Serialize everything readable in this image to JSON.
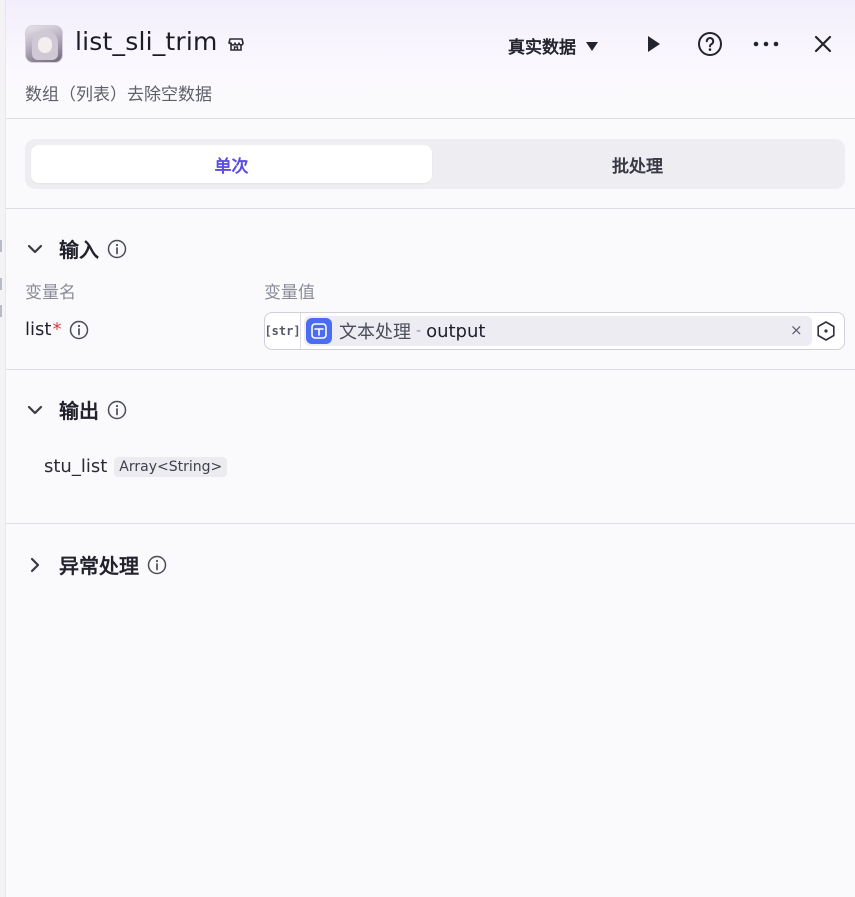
{
  "header": {
    "title": "list_sli_trim",
    "description": "数组（列表）去除空数据",
    "mode_select": "真实数据"
  },
  "tabs": [
    {
      "label": "单次",
      "active": true
    },
    {
      "label": "批处理",
      "active": false
    }
  ],
  "input_section": {
    "title": "输入",
    "col_name": "变量名",
    "col_value": "变量值",
    "row": {
      "name": "list",
      "required_mark": "*",
      "type_badge": "[str]",
      "ref_node": "文本处理",
      "ref_separator": "-",
      "ref_field": "output",
      "clear": "×"
    }
  },
  "output_section": {
    "title": "输出",
    "var_name": "stu_list",
    "var_type": "Array<String>"
  },
  "error_section": {
    "title": "异常处理"
  },
  "colors": {
    "accent": "#5a4de0",
    "node_icon": "#4a6cf0",
    "required": "#e0393b"
  }
}
